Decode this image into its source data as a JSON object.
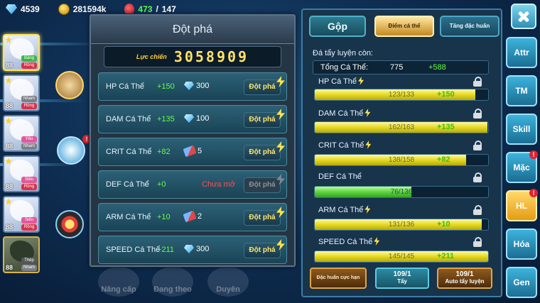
{
  "resources": {
    "gems": "4539",
    "gold": "281594k",
    "energy_current": "473",
    "energy_sep": "/",
    "energy_max": "147"
  },
  "roster": [
    {
      "level": "88",
      "tag1": "Băng",
      "tag2": "Rồng",
      "selected": true
    },
    {
      "level": "88",
      "tag1": "Nham",
      "tag2": "Rồng"
    },
    {
      "level": "88",
      "tag1": "Yêu",
      "tag2": "Nham"
    },
    {
      "level": "88",
      "tag1": "Siêu",
      "tag2": "Rồng"
    },
    {
      "level": "88",
      "tag1": "Siêu",
      "tag2": "Rồng"
    },
    {
      "level": "88",
      "tag1": "Thép",
      "tag2": "Nham"
    }
  ],
  "side_alert": "!",
  "bottom_buttons": [
    "Nâng cấp",
    "Đang theo",
    "Duyên"
  ],
  "breakthrough": {
    "title": "Đột phá",
    "power_label": "Lực chiến",
    "power_value": "3058909",
    "button_label": "Đột phá",
    "rows": [
      {
        "name": "HP Cá Thể",
        "bonus": "+150",
        "cost_icon": "diamond-icon",
        "cost": "300",
        "locked": false
      },
      {
        "name": "DAM Cá Thể",
        "bonus": "+135",
        "cost_icon": "diamond-icon",
        "cost": "100",
        "locked": false
      },
      {
        "name": "CRIT Cá Thể",
        "bonus": "+82",
        "cost_icon": "book-icon",
        "cost": "5",
        "locked": false
      },
      {
        "name": "DEF Cá Thể",
        "bonus": "+0",
        "cost_icon": "",
        "cost": "",
        "locked": true,
        "locked_text": "Chưa mở"
      },
      {
        "name": "ARM Cá Thể",
        "bonus": "+10",
        "cost_icon": "book-icon",
        "cost": "2",
        "locked": false
      },
      {
        "name": "SPEED Cá Thể",
        "bonus": "+211",
        "cost_icon": "diamond-icon",
        "cost": "300",
        "locked": false
      }
    ]
  },
  "training": {
    "tabs": [
      "Gộp",
      "Điểm cá thể",
      "Tăng đặc huấn"
    ],
    "remaining_label": "Đá tẩy luyện còn:",
    "total_label": "Tổng Cá Thể:",
    "total_value": "775",
    "total_bonus": "+588",
    "stats": [
      {
        "name": "HP Cá Thể",
        "bar_text": "123/133",
        "fill": 0.925,
        "bonus": "+150",
        "color": "yellow",
        "bolt": true
      },
      {
        "name": "DAM Cá Thể",
        "bar_text": "162/163",
        "fill": 0.994,
        "bonus": "+135",
        "color": "yellow",
        "bolt": true
      },
      {
        "name": "CRIT Cá Thể",
        "bar_text": "138/158",
        "fill": 0.873,
        "bonus": "+82",
        "color": "yellow",
        "bolt": true
      },
      {
        "name": "DEF Cá Thể",
        "bar_text": "76/136",
        "fill": 0.559,
        "bonus": "",
        "color": "green",
        "bolt": false
      },
      {
        "name": "ARM Cá Thể",
        "bar_text": "131/136",
        "fill": 0.963,
        "bonus": "+10",
        "color": "yellow",
        "bolt": true
      },
      {
        "name": "SPEED Cá Thể",
        "bar_text": "145/145",
        "fill": 1.0,
        "bonus": "+211",
        "color": "yellow",
        "bolt": true
      }
    ],
    "buttons": {
      "special_training": "Đặc huấn cực hạn",
      "wash_count": "109/1",
      "wash_label": "Tẩy",
      "auto_count": "109/1",
      "auto_label": "Auto tẩy luyện"
    }
  },
  "nav": [
    "Attr",
    "TM",
    "Skill",
    "Mặc",
    "HL",
    "Hóa",
    "Gen"
  ],
  "nav_alert": "!",
  "colors": {
    "accent": "#ffe26a",
    "bonus": "#62ff3e",
    "locked": "#ff4e4e"
  }
}
